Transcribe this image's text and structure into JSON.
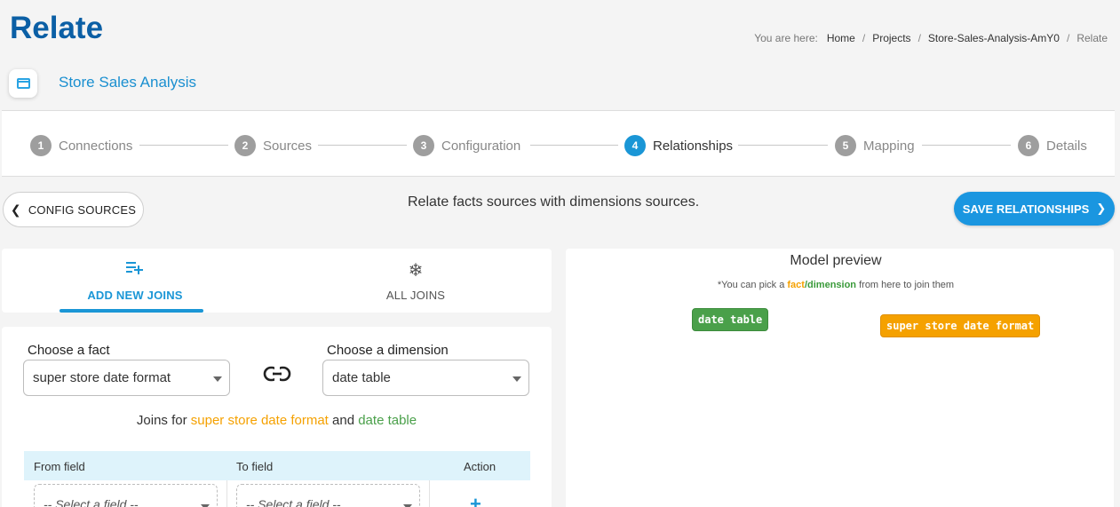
{
  "header": {
    "title": "Relate",
    "breadcrumb": {
      "label": "You are here:",
      "items": [
        "Home",
        "Projects",
        "Store-Sales-Analysis-AmY0"
      ],
      "current": "Relate"
    }
  },
  "project": {
    "name": "Store Sales Analysis",
    "icon": "folder-icon"
  },
  "stepper": {
    "steps": [
      {
        "num": "1",
        "label": "Connections",
        "active": false
      },
      {
        "num": "2",
        "label": "Sources",
        "active": false
      },
      {
        "num": "3",
        "label": "Configuration",
        "active": false
      },
      {
        "num": "4",
        "label": "Relationships",
        "active": true
      },
      {
        "num": "5",
        "label": "Mapping",
        "active": false
      },
      {
        "num": "6",
        "label": "Details",
        "active": false
      }
    ]
  },
  "actions": {
    "back_label": "CONFIG SOURCES",
    "hint": "Relate facts sources with dimensions sources.",
    "save_label": "SAVE RELATIONSHIPS"
  },
  "tabs": [
    {
      "label": "ADD NEW JOINS",
      "icon": "playlist-add-icon",
      "active": true
    },
    {
      "label": "ALL JOINS",
      "icon": "snowflake-icon",
      "active": false
    }
  ],
  "form": {
    "fact_label": "Choose a fact",
    "fact_value": "super store date format",
    "dimension_label": "Choose a dimension",
    "dimension_value": "date table",
    "joins_prefix": "Joins for",
    "joins_fact": "super store date format",
    "joins_and": "and",
    "joins_dim": "date table"
  },
  "join_table": {
    "columns": [
      "From field",
      "To field",
      "Action"
    ],
    "from_placeholder": "-- Select a field --",
    "to_placeholder": "-- Select a field --",
    "add_symbol": "+"
  },
  "preview": {
    "title": "Model preview",
    "note_prefix": "*You can pick a",
    "note_fact": "fact",
    "note_slash": "/",
    "note_dim": "dimension",
    "note_suffix": "from here to join them",
    "dimension_node": "date table",
    "fact_node": "super store date format"
  },
  "colors": {
    "accent": "#1a96d6",
    "fact": "#f5a100",
    "dimension": "#4aa04a",
    "title": "#0b5fa5"
  }
}
